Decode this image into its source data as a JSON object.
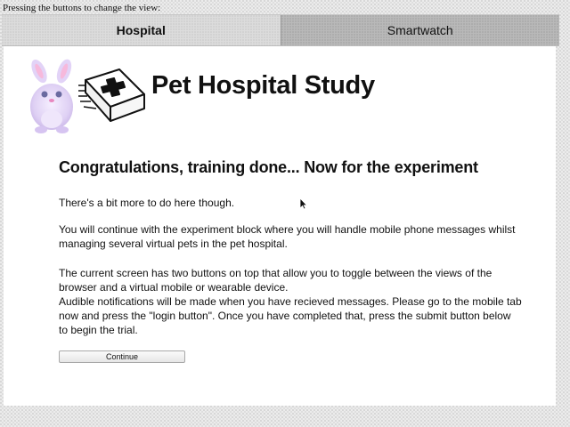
{
  "top_note": "Pressing the buttons to change the view:",
  "tabs": [
    {
      "label": "Hospital",
      "active": true
    },
    {
      "label": "Smartwatch",
      "active": false
    }
  ],
  "header": {
    "title": "Pet Hospital Study",
    "logo_icons": [
      "bunny-mascot-icon",
      "medical-kit-icon"
    ]
  },
  "main": {
    "headline": "Congratulations, training done... Now for the experiment",
    "paragraphs": [
      "There's a bit more to do here though.",
      "You will continue with the experiment block where you will handle mobile phone messages whilst managing several virtual pets in the pet hospital.",
      "The current screen has two buttons on top that allow you to toggle between the views of the browser and a virtual mobile or wearable device.\nAudible notifications will be made when you have recieved messages. Please go to the mobile tab now and press the \"login button\". Once you have completed that, press the submit button below to begin the trial."
    ],
    "continue_label": "Continue"
  },
  "colors": {
    "background": "#ececec",
    "panel": "#ffffff",
    "active_tab": "#dcdcdc",
    "inactive_tab": "#b9b9b9",
    "text": "#111111"
  }
}
